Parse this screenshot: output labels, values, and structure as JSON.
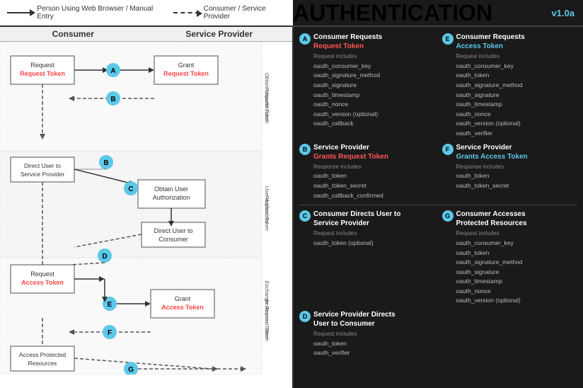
{
  "title": "OAUTH AUTHENTICATION FLOW",
  "version": "v1.0a",
  "legend": {
    "solid_label": "Person Using Web Browser / Manual Entry",
    "dashed_label": "Consumer / Service Provider"
  },
  "diagram": {
    "col1_header": "Consumer",
    "col2_header": "Service Provider",
    "section_labels": [
      "Obtain Unauthorized Request Token",
      "User Authorizes Request Token",
      "Exchange Request Token for Access Token"
    ]
  },
  "info_blocks": [
    {
      "id": "A",
      "title": "Consumer Requests",
      "title_highlight": "Request Token",
      "highlight_type": "red",
      "body_label": "Request includes",
      "body_items": [
        "oauth_consumer_key",
        "oauth_signature_method",
        "oauth_signature",
        "oauth_timestamp",
        "oauth_nonce",
        "oauth_version (optional)",
        "oauth_callback"
      ]
    },
    {
      "id": "E",
      "title": "Consumer Requests",
      "title_highlight": "Access Token",
      "highlight_type": "cyan",
      "body_label": "Request includes",
      "body_items": [
        "oauth_consumer_key",
        "oauth_token",
        "oauth_signature_method",
        "oauth_signature",
        "oauth_timestamp",
        "oauth_nonce",
        "oauth_version (optional)",
        "oauth_verifier"
      ]
    },
    {
      "id": "B",
      "title": "Service Provider",
      "title_highlight": "Grants Request Token",
      "highlight_type": "red",
      "body_label": "Response includes",
      "body_items": [
        "oauth_token",
        "oauth_token_secret",
        "oauth_callback_confirmed"
      ]
    },
    {
      "id": "F",
      "title": "Service Provider",
      "title_highlight": "Grants Access Token",
      "highlight_type": "cyan",
      "body_label": "Response includes",
      "body_items": [
        "oauth_token",
        "oauth_token_secret"
      ]
    },
    {
      "id": "C",
      "title": "Consumer Directs User to",
      "title_highlight": "Service Provider",
      "highlight_type": "none",
      "body_label": "Request includes",
      "body_items": [
        "oauth_token (optional)"
      ]
    },
    {
      "id": "G",
      "title": "Consumer Accesses",
      "title_highlight": "Protected Resources",
      "highlight_type": "none",
      "body_label": "Request includes",
      "body_items": [
        "oauth_consumer_key",
        "oauth_token",
        "oauth_signature_method",
        "oauth_signature",
        "oauth_timestamp",
        "oauth_nonce",
        "oauth_version (optional)"
      ]
    },
    {
      "id": "D",
      "title": "Service Provider Directs",
      "title_highlight": "User to Consumer",
      "highlight_type": "none",
      "body_label": "Request includes",
      "body_items": [
        "oauth_token",
        "oauth_verifier"
      ]
    }
  ]
}
